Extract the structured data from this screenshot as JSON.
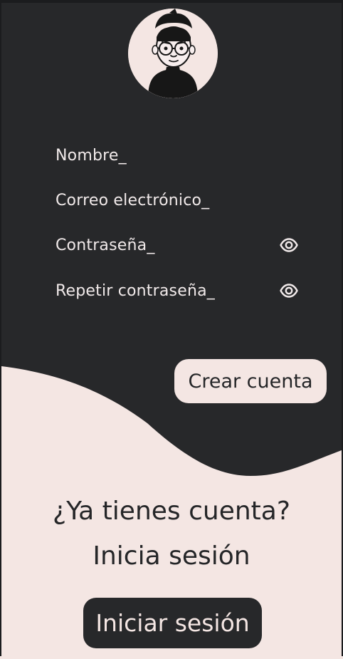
{
  "avatar": {
    "icon": "avatar-icon"
  },
  "form": {
    "fields": [
      {
        "label": "Nombre_"
      },
      {
        "label": "Correo electrónico_"
      },
      {
        "label": "Contraseña_",
        "icon": "eye-icon"
      },
      {
        "label": "Repetir contraseña_",
        "icon": "eye-icon"
      }
    ],
    "submit_label": "Crear cuenta"
  },
  "login": {
    "question": "¿Ya tienes cuenta?",
    "prompt": "Inicia sesión",
    "button_label": "Iniciar sesión"
  },
  "colors": {
    "background_dark": "#27282a",
    "background_light": "#f4e6e3",
    "text_light": "#f1eaea",
    "text_dark": "#252628"
  }
}
